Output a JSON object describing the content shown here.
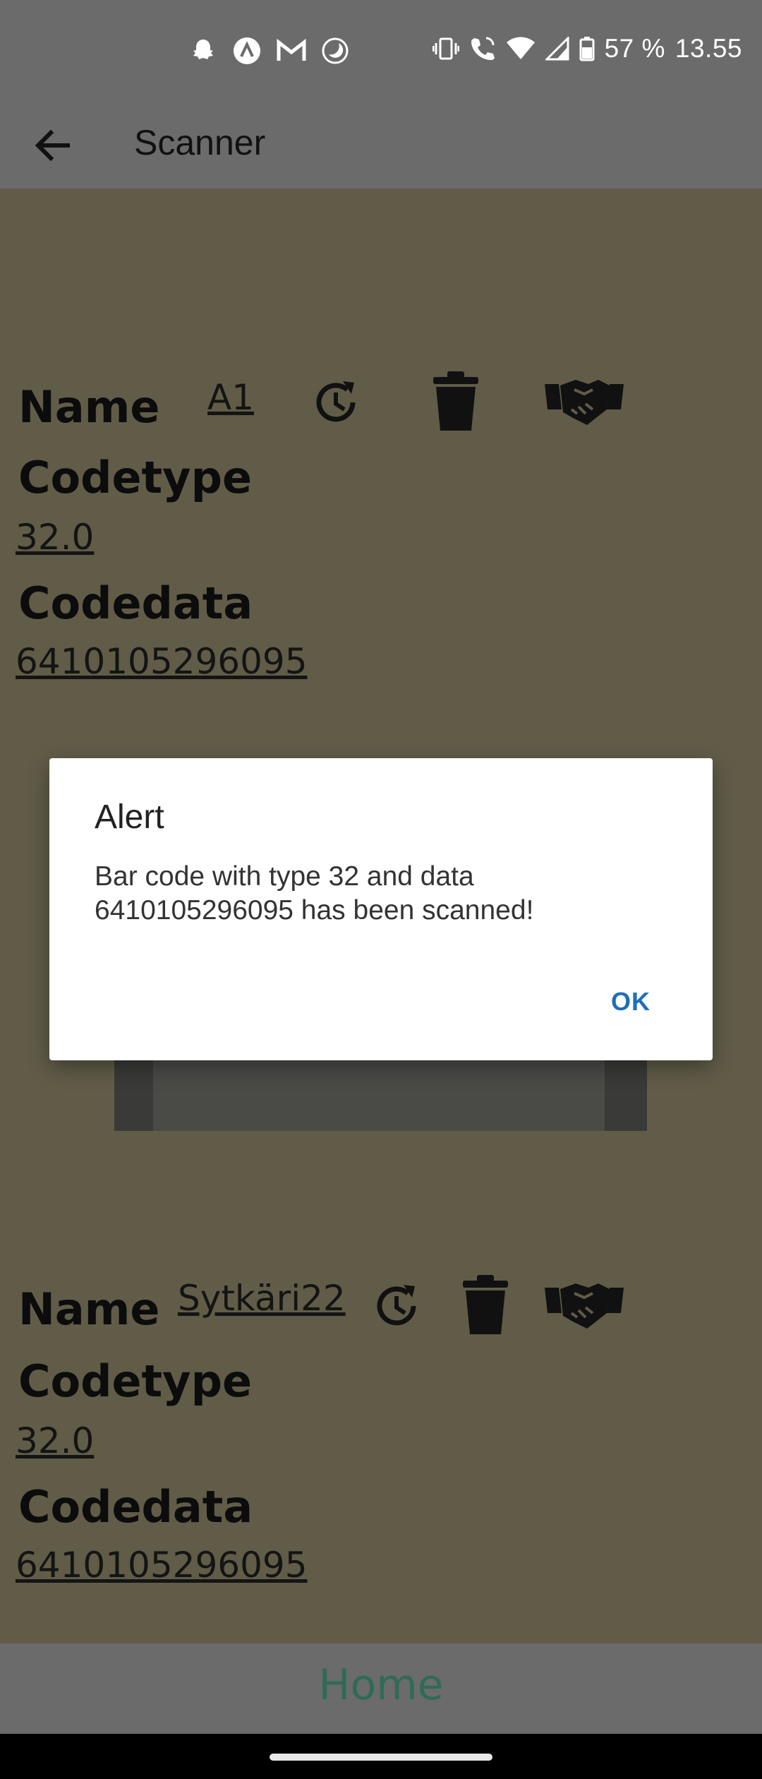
{
  "status_bar": {
    "battery_text": "57 %",
    "time": "13.55",
    "left_icons": [
      "snapchat-icon",
      "arrow-app-icon",
      "gmail-icon",
      "moon-icon"
    ],
    "right_icons": [
      "vibrate-icon",
      "wifi-call-icon",
      "wifi-icon",
      "signal-icon",
      "battery-icon"
    ]
  },
  "app_bar": {
    "title": "Scanner"
  },
  "items": [
    {
      "name_label": "Name",
      "name_value": "A1",
      "codetype_label": "Codetype",
      "codetype_value": "32.0",
      "codedata_label": "Codedata",
      "codedata_value": "6410105296095"
    },
    {
      "name_label": "Name",
      "name_value": "Sytkäri22",
      "codetype_label": "Codetype",
      "codetype_value": "32.0",
      "codedata_label": "Codedata",
      "codedata_value": "6410105296095"
    }
  ],
  "dialog": {
    "title": "Alert",
    "message": "Bar code with type 32 and data 6410105296095 has been scanned!",
    "ok_label": "OK"
  },
  "bottom_nav": {
    "home_label": "Home"
  },
  "colors": {
    "overlay_background": "#615c48",
    "bar_background": "#6b6b6b",
    "dialog_accent": "#1e6fb8",
    "home_text": "#2f6b57"
  }
}
